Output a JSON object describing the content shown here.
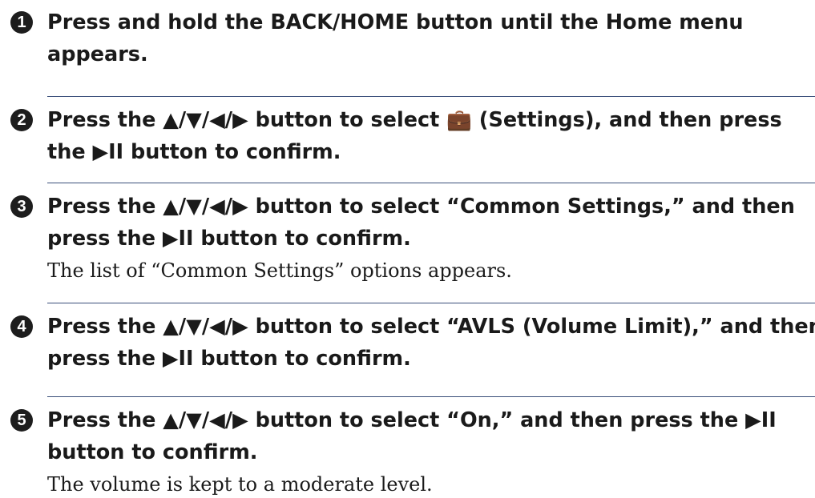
{
  "steps": [
    {
      "number": "1",
      "title_lines": [
        "Press and hold the BACK/HOME button until the Home menu",
        "appears."
      ],
      "description": ""
    },
    {
      "number": "2",
      "title_lines": [
        "Press the ▲/▼/◀/▶ button to select 💼 (Settings), and then press",
        "the ▶II button to confirm."
      ],
      "description": ""
    },
    {
      "number": "3",
      "title_lines": [
        "Press the ▲/▼/◀/▶ button to select “Common Settings,” and then",
        "press the ▶II button to confirm."
      ],
      "description": "The list of “Common Settings” options appears."
    },
    {
      "number": "4",
      "title_lines": [
        "Press the ▲/▼/◀/▶ button to select “AVLS (Volume Limit),” and then",
        "press the ▶II button to confirm."
      ],
      "description": ""
    },
    {
      "number": "5",
      "title_lines": [
        "Press the ▲/▼/◀/▶ button to select “On,” and then press the ▶II",
        "button to confirm."
      ],
      "description": "The volume is kept to a moderate level."
    }
  ],
  "icons": {
    "settings": "toolbox-icon"
  },
  "colors": {
    "divider": "#3a4f7a",
    "text": "#1a1a1a",
    "number_badge": "#1d1d1d"
  }
}
